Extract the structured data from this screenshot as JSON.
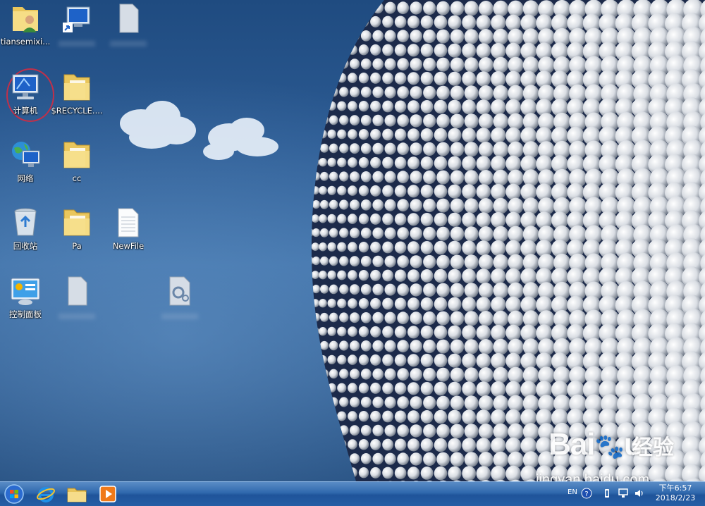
{
  "desktop_icons": [
    {
      "id": "user-folder",
      "label": "tiansemixi...",
      "icon": "user-folder-icon",
      "blur": false
    },
    {
      "id": "network-shortcut",
      "label": "",
      "icon": "network-shortcut-icon",
      "blur": true
    },
    {
      "id": "file-blank-1",
      "label": "",
      "icon": "file-icon",
      "blur": true
    },
    {
      "id": "computer",
      "label": "计算机",
      "icon": "computer-icon",
      "blur": false
    },
    {
      "id": "recycle-folder",
      "label": "$RECYCLE....",
      "icon": "folder-icon",
      "blur": false
    },
    {
      "id": "network",
      "label": "网络",
      "icon": "network-globe-icon",
      "blur": false
    },
    {
      "id": "cc-folder",
      "label": "cc",
      "icon": "folder-icon",
      "blur": false
    },
    {
      "id": "recycle-bin",
      "label": "回收站",
      "icon": "recycle-bin-icon",
      "blur": false
    },
    {
      "id": "pa-folder",
      "label": "Pa",
      "icon": "folder-icon",
      "blur": false
    },
    {
      "id": "newfile",
      "label": "NewFile",
      "icon": "text-file-icon",
      "blur": false
    },
    {
      "id": "control-panel",
      "label": "控制面板",
      "icon": "control-panel-icon",
      "blur": false
    },
    {
      "id": "file-blank-2",
      "label": "",
      "icon": "file-icon",
      "blur": true
    },
    {
      "id": "config-file",
      "label": "",
      "icon": "settings-file-icon",
      "blur": true
    }
  ],
  "taskbar": {
    "items": [
      "start-orb-icon",
      "ie-icon",
      "explorer-folder-icon",
      "media-player-icon"
    ],
    "tray": {
      "language": "EN",
      "icons": [
        "help-icon",
        "usb-icon",
        "network-tray-icon",
        "volume-icon"
      ]
    },
    "clock_time": "下午6:57",
    "clock_date": "2018/2/23"
  },
  "watermark": {
    "brand": "Bai",
    "brand_suffix": "u",
    "cn": "经验",
    "url": "jingyan.baidu.com"
  },
  "colors": {
    "desktop_top": "#1f4b80",
    "taskbar": "#2f68ad",
    "highlight_circle": "#c0304a",
    "folder": "#f3d27a"
  }
}
